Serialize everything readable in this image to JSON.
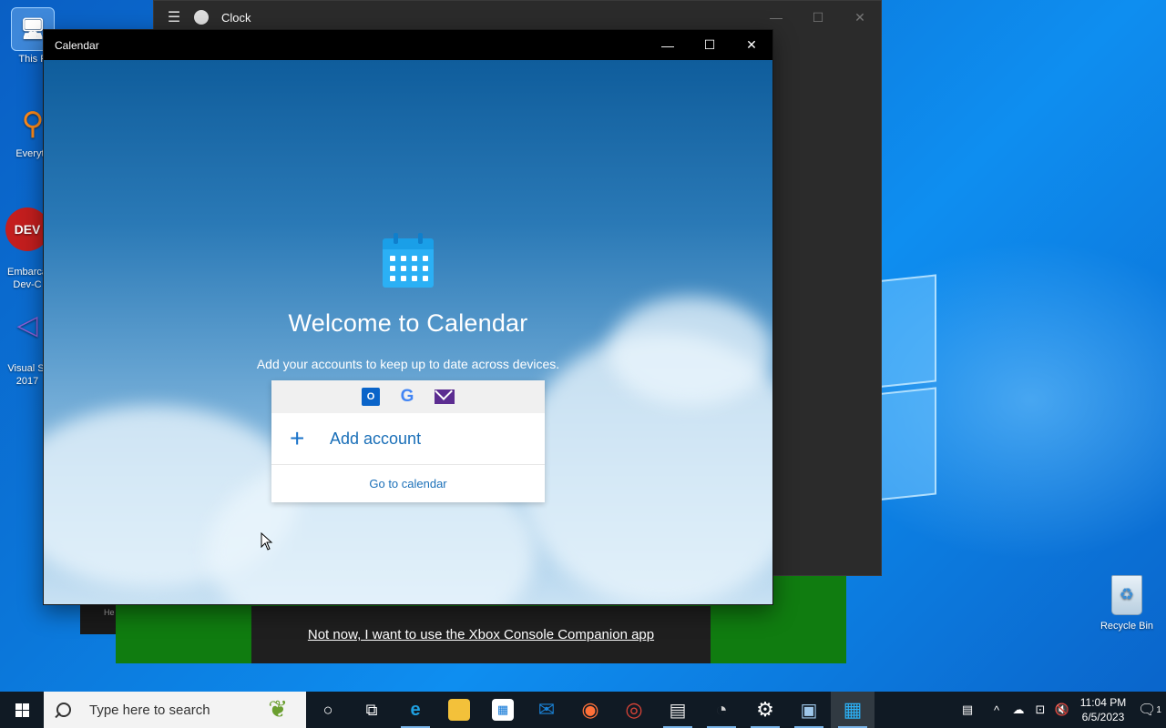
{
  "desktop": {
    "icons": [
      {
        "label": "This P"
      },
      {
        "label": "Everyth"
      },
      {
        "label": "Embarca\nDev-C"
      },
      {
        "label": "Visual St\n2017"
      }
    ],
    "recycle_bin_label": "Recycle Bin"
  },
  "clock_window": {
    "title": "Clock",
    "controls": {
      "minimize": "—",
      "maximize": "☐",
      "close": "✕"
    }
  },
  "xbox_window": {
    "link_text": "Not now, I want to use the Xbox Console Companion app",
    "side_text": "He"
  },
  "calendar_window": {
    "title": "Calendar",
    "controls": {
      "minimize": "—",
      "maximize": "☐",
      "close": "✕"
    },
    "welcome_title": "Welcome to Calendar",
    "welcome_subtitle": "Add your accounts to keep up to date across devices.",
    "providers": [
      "outlook-icon",
      "google-icon",
      "mail-icon"
    ],
    "add_account_label": "Add account",
    "go_to_calendar_label": "Go to calendar"
  },
  "taskbar": {
    "search_placeholder": "Type here to search",
    "apps": [
      {
        "name": "cortana",
        "glyph": "○"
      },
      {
        "name": "task-view",
        "glyph": "⧉"
      },
      {
        "name": "edge",
        "glyph": "e",
        "color": "#1fa0e0"
      },
      {
        "name": "file-explorer",
        "glyph": "▬",
        "color": "#f3c13a"
      },
      {
        "name": "store",
        "glyph": "▦",
        "color": "#0a74d6"
      },
      {
        "name": "mail",
        "glyph": "✉",
        "color": "#1a82d6"
      },
      {
        "name": "firefox",
        "glyph": "◉",
        "color": "#ff7139"
      },
      {
        "name": "chrome",
        "glyph": "◎",
        "color": "#db4437"
      },
      {
        "name": "books",
        "glyph": "▤",
        "color": "#e5e5e5"
      },
      {
        "name": "clock",
        "glyph": "◔",
        "color": "#cfcfcf"
      },
      {
        "name": "settings",
        "glyph": "⚙",
        "color": "#ffffff"
      },
      {
        "name": "network-app",
        "glyph": "▣",
        "color": "#9ec7ea"
      },
      {
        "name": "calendar",
        "glyph": "▦",
        "color": "#2bb0f5"
      }
    ],
    "tray": {
      "time": "11:04 PM",
      "date": "6/5/2023",
      "notification_count": "1"
    }
  }
}
